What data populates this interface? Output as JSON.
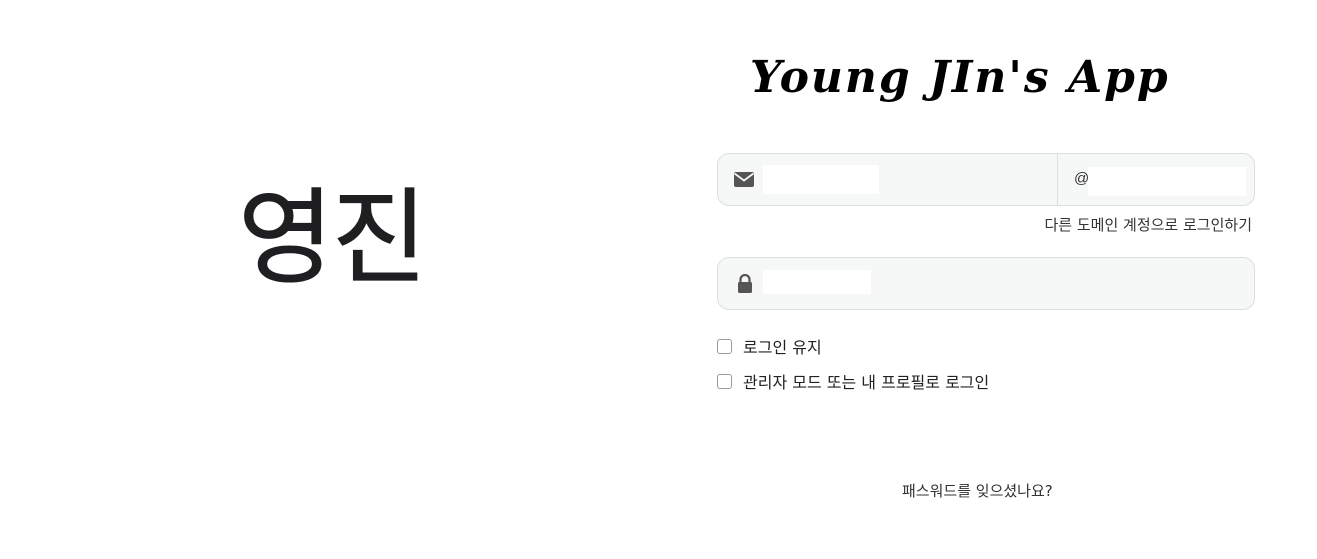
{
  "logo": {
    "korean_text": "영진"
  },
  "app": {
    "title": "Young JIn's App"
  },
  "login_form": {
    "email": {
      "icon": "envelope-icon",
      "value": "",
      "placeholder": ""
    },
    "domain": {
      "prefix": "@",
      "value": "",
      "placeholder": ""
    },
    "other_domain_link": "다른 도메인 계정으로 로그인하기",
    "password": {
      "icon": "lock-icon",
      "value": "",
      "placeholder": ""
    },
    "options": {
      "keep_login_label": "로그인 유지",
      "keep_login_checked": false,
      "admin_mode_label": "관리자 모드 또는 내 프로필로 로그인",
      "admin_mode_checked": false
    },
    "forgot_password_link": "패스워드를 잊으셨나요?"
  },
  "colors": {
    "field_background": "#f6f7f7",
    "field_border": "#dcdfe1",
    "icon": "#555555",
    "text": "#333333"
  }
}
